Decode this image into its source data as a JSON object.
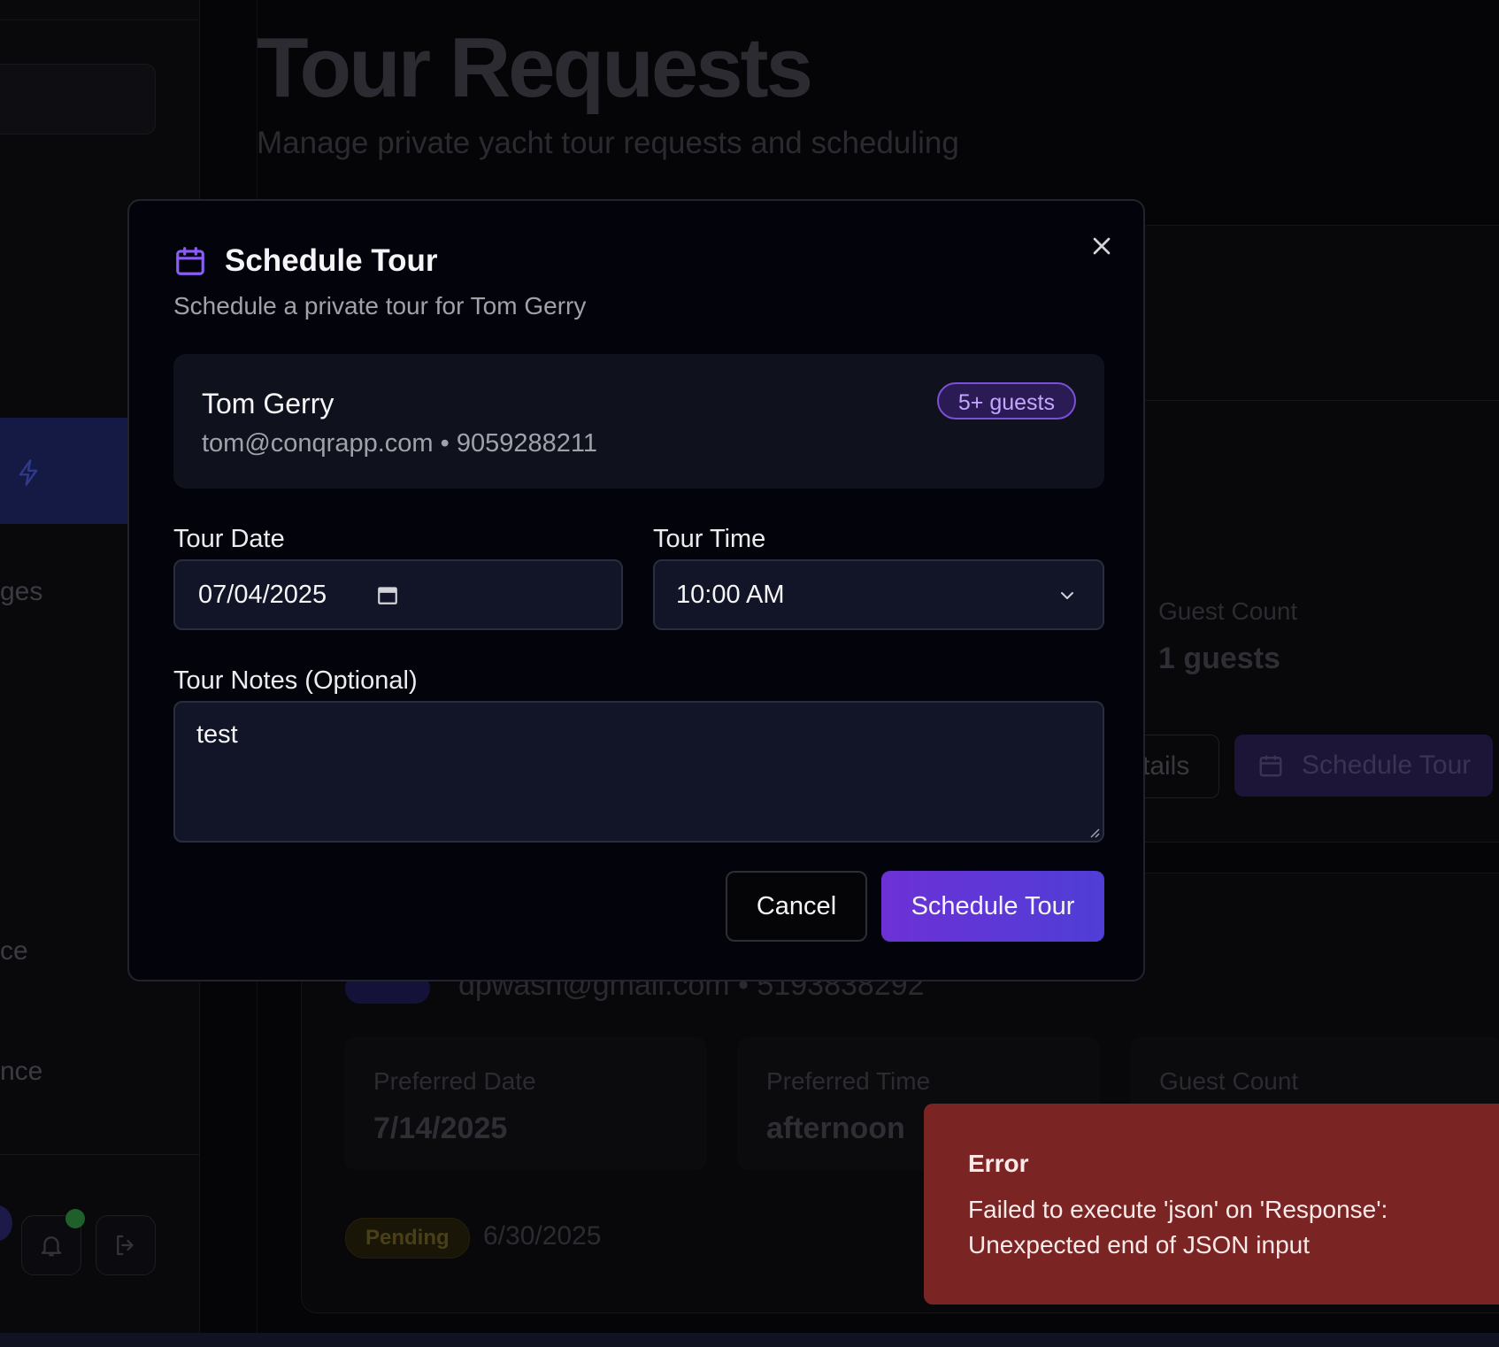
{
  "page": {
    "title": "Tour Requests",
    "subtitle": "Manage private yacht tour requests and scheduling"
  },
  "sidebar": {
    "partial_items": [
      "ges",
      "ce",
      "nce"
    ]
  },
  "background_cards": {
    "card1": {
      "guest_count_label": "Guest Count",
      "guest_count_value": "1 guests",
      "details_button": "tails",
      "schedule_button": "Schedule Tour"
    },
    "card2": {
      "contact": "dpwash@gmail.com • 5193838292",
      "preferred_date_label": "Preferred Date",
      "preferred_date_value": "7/14/2025",
      "preferred_time_label": "Preferred Time",
      "preferred_time_value": "afternoon",
      "guest_count_label": "Guest Count",
      "status": "Pending",
      "created_date": "6/30/2025"
    }
  },
  "modal": {
    "title": "Schedule Tour",
    "subtitle": "Schedule a private tour for Tom Gerry",
    "customer": {
      "name": "Tom Gerry",
      "contact": "tom@conqrapp.com • 9059288211",
      "guests_badge": "5+ guests"
    },
    "date_label": "Tour Date",
    "date_value": "07/04/2025",
    "time_label": "Tour Time",
    "time_value": "10:00 AM",
    "notes_label": "Tour Notes (Optional)",
    "notes_value": "test",
    "cancel_label": "Cancel",
    "submit_label": "Schedule Tour",
    "accent_color": "#8b5cf6"
  },
  "toast": {
    "title": "Error",
    "message": "Failed to execute 'json' on 'Response': Unexpected end of JSON input",
    "color": "#7a2424"
  }
}
